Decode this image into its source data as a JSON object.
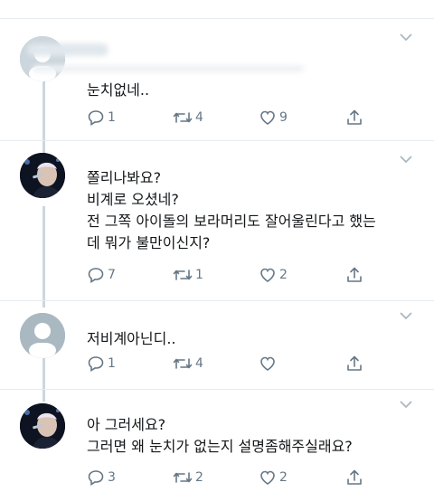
{
  "tweets": [
    {
      "text": "눈치없네..",
      "reply_count": "1",
      "retweet_count": "4",
      "like_count": "9"
    },
    {
      "text": "쫄리나봐요?\n비계로 오셨네?\n전 그쪽 아이돌의 보라머리도 잘어울린다고 했는\n데 뭐가 불만이신지?",
      "reply_count": "7",
      "retweet_count": "1",
      "like_count": "2"
    },
    {
      "text": "저비계아닌디..",
      "reply_count": "1",
      "retweet_count": "4",
      "like_count": ""
    },
    {
      "text": "아 그러세요?\n그러면 왜 눈치가 없는지 설명좀해주실래요?",
      "reply_count": "3",
      "retweet_count": "2",
      "like_count": "2"
    }
  ],
  "icons": {
    "reply": "reply-icon",
    "retweet": "retweet-icon",
    "like": "heart-icon",
    "share": "share-icon",
    "menu": "chevron-down-icon"
  },
  "colors": {
    "icon_gray": "#657786",
    "divider": "#e6ecf0",
    "thread_line": "#ccd6dd"
  }
}
